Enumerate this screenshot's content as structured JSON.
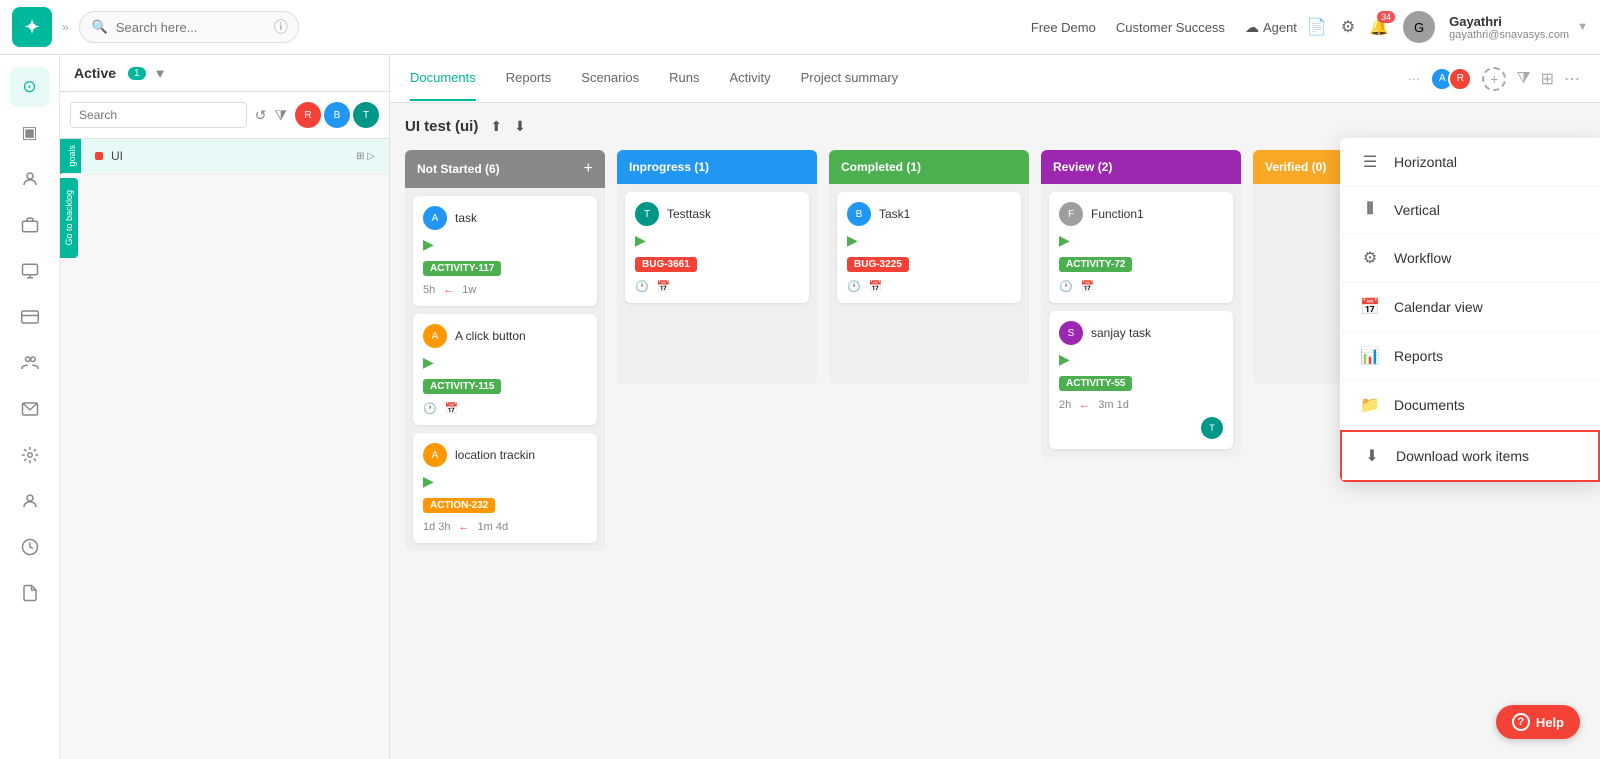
{
  "topnav": {
    "logo": "✦",
    "search_placeholder": "Search here...",
    "free_demo": "Free Demo",
    "customer_success": "Customer Success",
    "agent": "Agent",
    "notification_count": "34",
    "user_name": "Gayathri",
    "user_email": "gayathri@snavasys.com"
  },
  "sidebar_icons": [
    {
      "name": "home-icon",
      "icon": "⊙"
    },
    {
      "name": "tv-icon",
      "icon": "▣"
    },
    {
      "name": "user-icon",
      "icon": "👤"
    },
    {
      "name": "briefcase-icon",
      "icon": "💼"
    },
    {
      "name": "monitor-icon",
      "icon": "🖥"
    },
    {
      "name": "card-icon",
      "icon": "💳"
    },
    {
      "name": "team-icon",
      "icon": "👥"
    },
    {
      "name": "mail-icon",
      "icon": "✉"
    },
    {
      "name": "settings-icon",
      "icon": "⚙"
    },
    {
      "name": "person-icon",
      "icon": "👤"
    },
    {
      "name": "clock-icon",
      "icon": "🕐"
    },
    {
      "name": "file-icon",
      "icon": "📄"
    }
  ],
  "active_panel": {
    "title": "Active",
    "badge": "1",
    "projects": [
      {
        "name": "UI",
        "indicator_color": "#f44336"
      }
    ]
  },
  "tabs": {
    "items": [
      {
        "label": "Documents"
      },
      {
        "label": "Reports"
      },
      {
        "label": "Scenarios"
      },
      {
        "label": "Runs"
      },
      {
        "label": "Activity"
      },
      {
        "label": "Project summary"
      }
    ],
    "active_index": 0
  },
  "search_label": "Search",
  "board": {
    "title": "UI test (ui)",
    "columns": [
      {
        "label": "Not Started (6)",
        "type": "not-started",
        "cards": [
          {
            "id": "ACTIVITY-117",
            "badge_class": "badge-green",
            "title": "task",
            "time": "5h",
            "arrow_time": "1w",
            "show_arrow": true,
            "avatar_color": "av-blue"
          },
          {
            "id": "ACTIVITY-115",
            "badge_class": "badge-green",
            "title": "A click button",
            "time": "",
            "show_arrow": false,
            "avatar_color": "av-orange"
          },
          {
            "id": "ACTION-232",
            "badge_class": "badge-orange",
            "title": "location trackin",
            "time": "1d 3h",
            "arrow_time": "1m 4d",
            "show_arrow": true,
            "avatar_color": "av-orange"
          }
        ]
      },
      {
        "label": "Inprogress (1)",
        "type": "inprogress",
        "cards": [
          {
            "id": "BUG-3661",
            "badge_class": "badge-red",
            "title": "Testtask",
            "time": "",
            "show_arrow": false,
            "avatar_color": "av-teal"
          }
        ]
      },
      {
        "label": "Completed (1)",
        "type": "completed",
        "cards": [
          {
            "id": "BUG-3225",
            "badge_class": "badge-red",
            "title": "Task1",
            "time": "",
            "show_arrow": false,
            "avatar_color": "av-blue"
          }
        ]
      },
      {
        "label": "Review (2)",
        "type": "review",
        "cards": [
          {
            "id": "ACTIVITY-72",
            "badge_class": "badge-green",
            "title": "Function1",
            "time": "",
            "show_arrow": false,
            "avatar_color": "av-grey"
          },
          {
            "id": "ACTIVITY-55",
            "badge_class": "badge-green",
            "title": "sanjay task",
            "time": "2h",
            "arrow_time": "3m 1d",
            "show_arrow": true,
            "avatar_color": "av-purple"
          }
        ]
      },
      {
        "label": "Verified (0)",
        "type": "verified",
        "cards": []
      }
    ]
  },
  "dropdown_menu": {
    "items": [
      {
        "label": "Horizontal",
        "icon": "☰",
        "name": "horizontal"
      },
      {
        "label": "Vertical",
        "icon": "⦀",
        "name": "vertical"
      },
      {
        "label": "Workflow",
        "icon": "⚙",
        "name": "workflow"
      },
      {
        "label": "Calendar view",
        "icon": "📅",
        "name": "calendar-view"
      },
      {
        "label": "Reports",
        "icon": "📊",
        "name": "reports"
      },
      {
        "label": "Documents",
        "icon": "📁",
        "name": "documents"
      },
      {
        "label": "Download work items",
        "icon": "⬇",
        "name": "download-work-items",
        "highlighted": true
      }
    ]
  },
  "help_button": {
    "label": "Help",
    "icon": "?"
  }
}
